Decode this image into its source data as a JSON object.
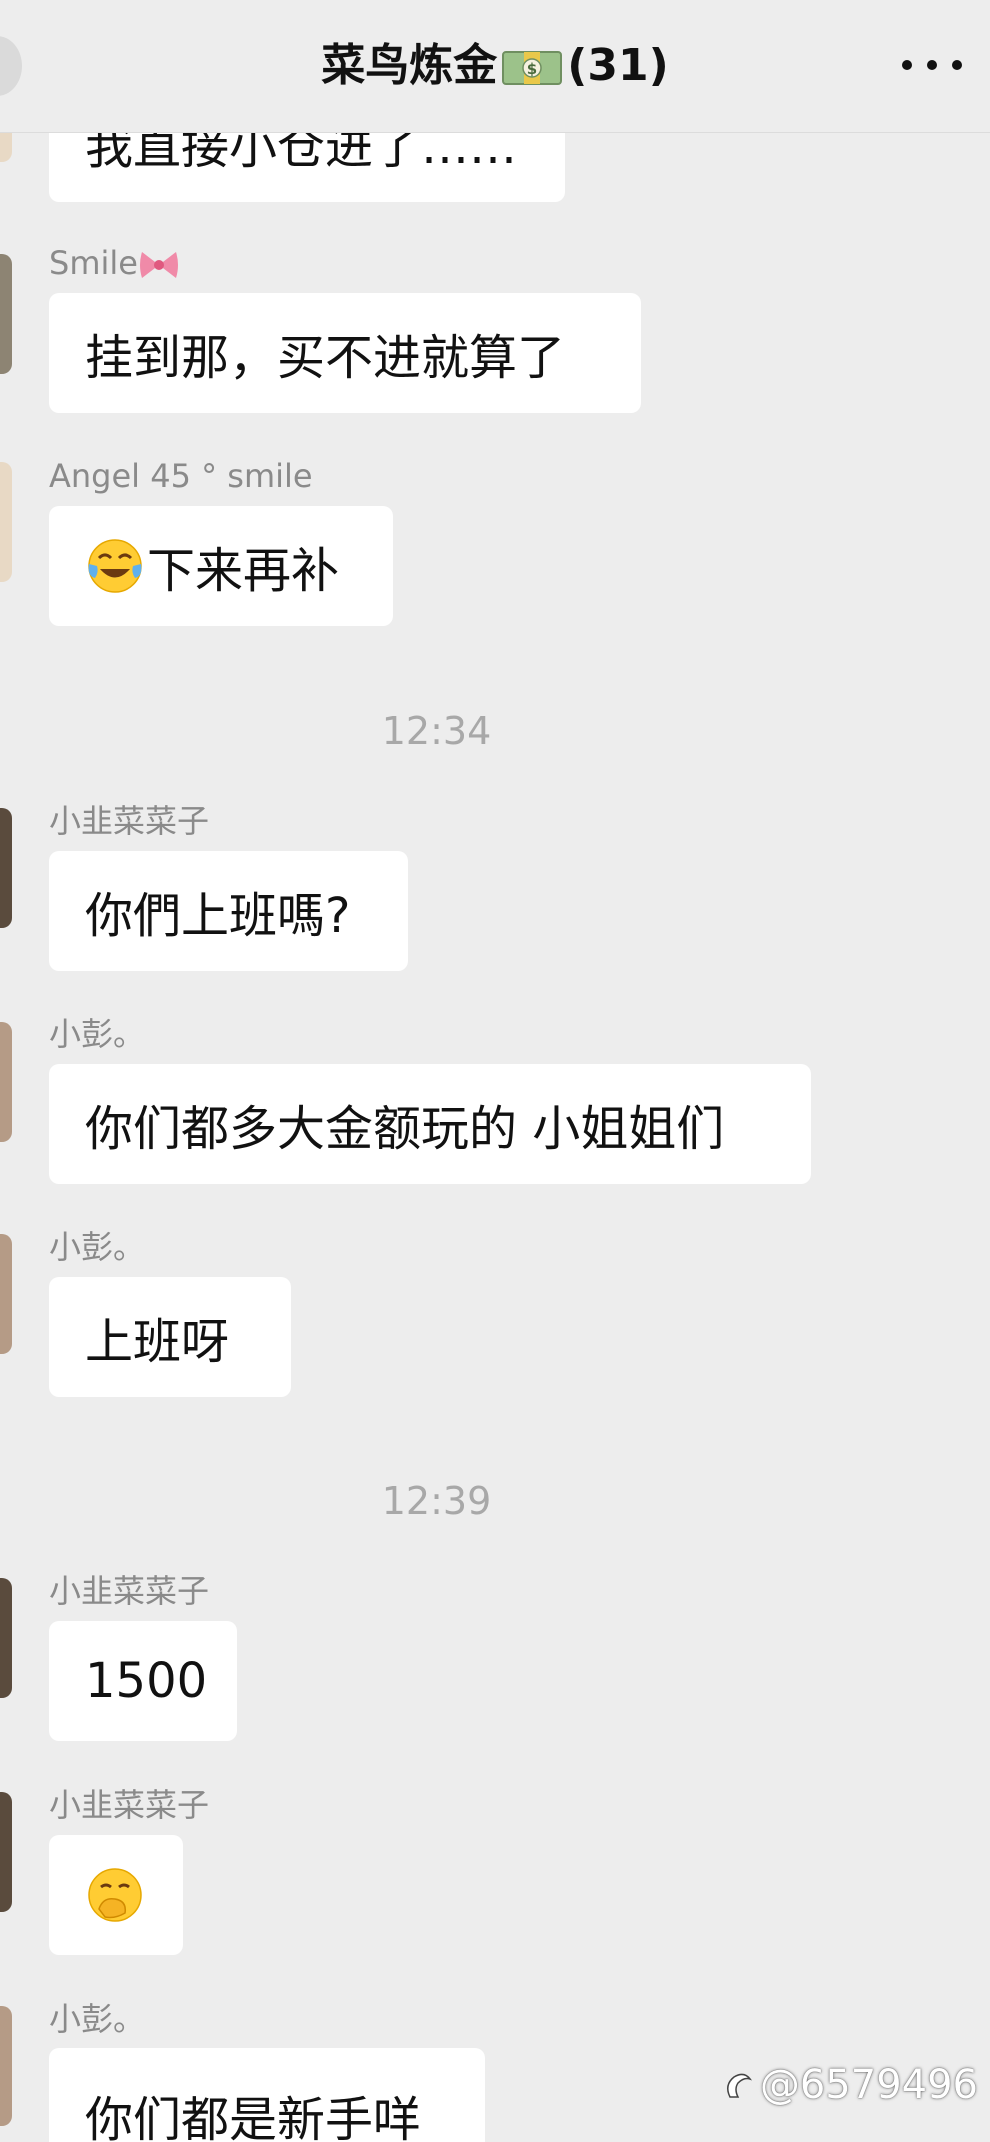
{
  "header": {
    "title": "菜鸟炼金",
    "member_count": "(31)",
    "title_icon": "money-bag-emoji",
    "menu_icon": "more-dots-icon"
  },
  "messages": [
    {
      "text": "我直接小仓进了……"
    },
    {
      "sender": "Smile",
      "sender_icon": "bow-emoji",
      "text": "挂到那，买不进就算了"
    },
    {
      "sender": "Angel  45 ° smile",
      "emoji": "tears-of-joy-emoji",
      "text": "下来再补"
    },
    {
      "sender": "小韭菜菜子",
      "text": "你們上班嗎?"
    },
    {
      "sender": "小彭。",
      "text": "你们都多大金额玩的 小姐姐们"
    },
    {
      "sender": "小彭。",
      "text": "上班呀"
    },
    {
      "sender": "小韭菜菜子",
      "text": "1500"
    },
    {
      "sender": "小韭菜菜子",
      "emoji": "hand-over-mouth-emoji",
      "text": ""
    },
    {
      "sender": "小彭。",
      "text": "你们都是新手咩"
    }
  ],
  "timestamps": [
    "12:34",
    "12:39"
  ],
  "watermark": "@6579496",
  "colors": {
    "background": "#ededed",
    "bubble": "#ffffff",
    "sender_text": "#8a8a8a",
    "timestamp_text": "#a8a8a8"
  }
}
